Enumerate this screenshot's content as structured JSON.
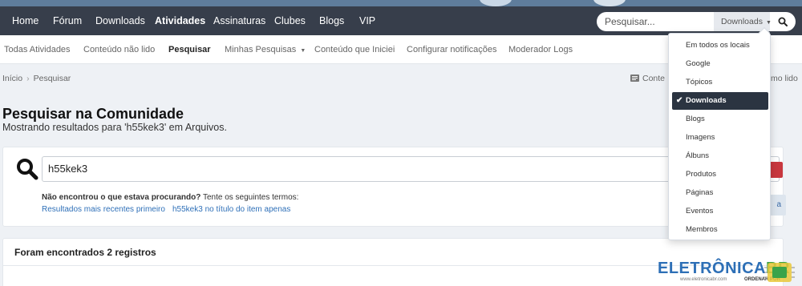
{
  "nav": {
    "items": [
      "Home",
      "Fórum",
      "Downloads",
      "Atividades",
      "Assinaturas",
      "Clubes",
      "Blogs",
      "VIP"
    ],
    "active": "Atividades"
  },
  "search": {
    "placeholder": "Pesquisar...",
    "scope": "Downloads"
  },
  "subnav": {
    "items": [
      "Todas Atividades",
      "Conteúdo não lido",
      "Pesquisar",
      "Minhas Pesquisas",
      "Conteúdo que Iniciei",
      "Configurar notificações",
      "Moderador Logs"
    ],
    "active": "Pesquisar"
  },
  "breadcrumb": {
    "home": "Início",
    "current": "Pesquisar",
    "right_1": "Conte",
    "right_2": "mo lido"
  },
  "page": {
    "title": "Pesquisar na Comunidade",
    "subtitle": "Mostrando resultados para 'h55kek3' em Arquivos."
  },
  "search_panel": {
    "query": "h55kek3",
    "hint_bold": "Não encontrou o que estava procurando?",
    "hint_rest": " Tente os seguintes termos:",
    "suggestion_1": "Resultados mais recentes primeiro",
    "suggestion_2": "h55kek3 no título do item apenas",
    "side_button": "a"
  },
  "results": {
    "title": "Foram encontrados 2 registros"
  },
  "dropdown": {
    "items": [
      "Em todos os locais",
      "Google",
      "Tópicos",
      "Downloads",
      "Blogs",
      "Imagens",
      "Álbuns",
      "Produtos",
      "Páginas",
      "Eventos",
      "Membros"
    ],
    "selected": "Downloads"
  },
  "watermark": {
    "brand": "ELETRÔNICA",
    "brand_suffix": "BR",
    "url": "www.eletronicabr.com",
    "sub": "ORDENAR POR"
  },
  "colors": {
    "nav_bg": "#373e4b",
    "accent_red": "#c8373e",
    "link_blue": "#2f70b8",
    "selected_bg": "#2b3441"
  }
}
